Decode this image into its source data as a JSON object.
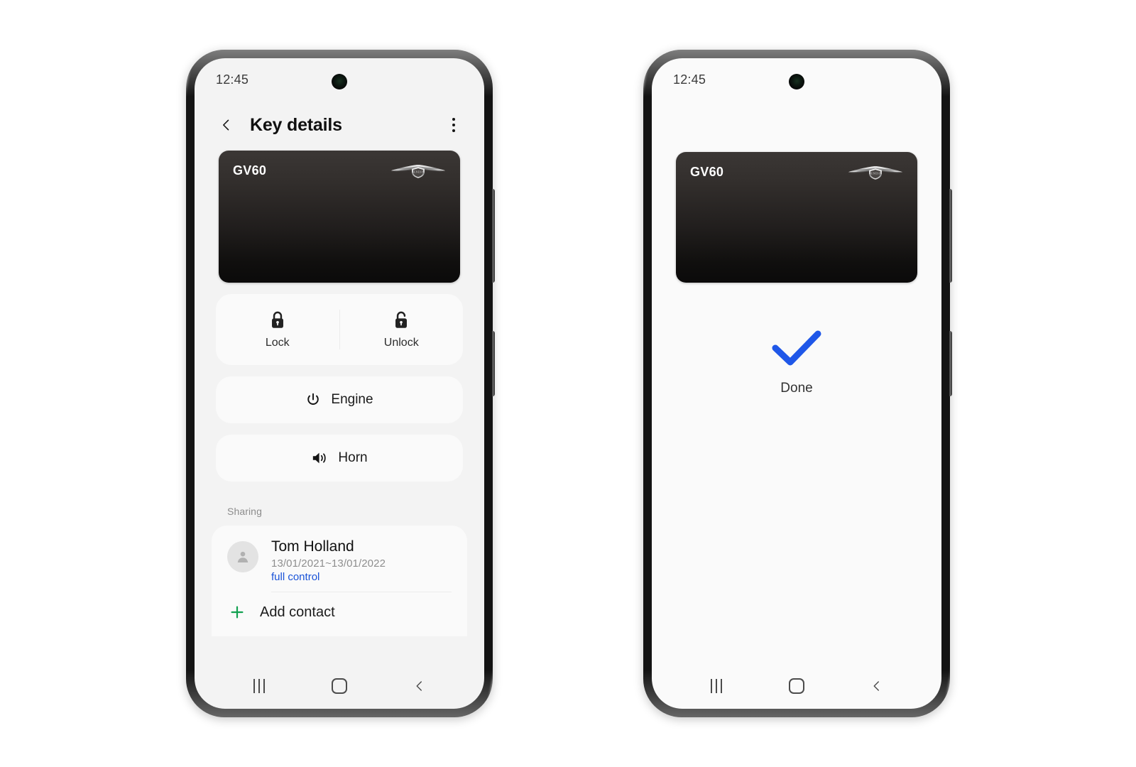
{
  "phones": [
    {
      "name": "key-details-screen",
      "status_bar": {
        "time": "12:45"
      },
      "app_bar": {
        "back_icon": "chevron-left-icon",
        "title": "Key details",
        "overflow_icon": "more-vertical-icon"
      },
      "key_card": {
        "model": "GV60",
        "brand_logo": "genesis-wings-logo"
      },
      "actions": {
        "lock": {
          "label": "Lock",
          "icon": "lock-closed-icon"
        },
        "unlock": {
          "label": "Unlock",
          "icon": "lock-open-icon"
        },
        "engine": {
          "label": "Engine",
          "icon": "power-icon"
        },
        "horn": {
          "label": "Horn",
          "icon": "speaker-icon"
        }
      },
      "sharing": {
        "section_label": "Sharing",
        "contact": {
          "avatar_icon": "person-icon",
          "name": "Tom Holland",
          "dates": "13/01/2021~13/01/2022",
          "permission": "full control",
          "permission_color": "#1a53d8"
        },
        "add_contact": {
          "label": "Add contact",
          "icon": "plus-icon",
          "icon_color": "#12a150"
        }
      },
      "nav_bar": {
        "recents_icon": "recents-icon",
        "home_icon": "home-icon",
        "back_icon": "back-icon"
      }
    },
    {
      "name": "done-confirmation-screen",
      "status_bar": {
        "time": "12:45"
      },
      "key_card": {
        "model": "GV60",
        "brand_logo": "genesis-wings-logo"
      },
      "result": {
        "check_icon": "check-icon",
        "check_color": "#1f57e8",
        "label": "Done"
      },
      "nav_bar": {
        "recents_icon": "recents-icon",
        "home_icon": "home-icon",
        "back_icon": "back-icon"
      }
    }
  ]
}
